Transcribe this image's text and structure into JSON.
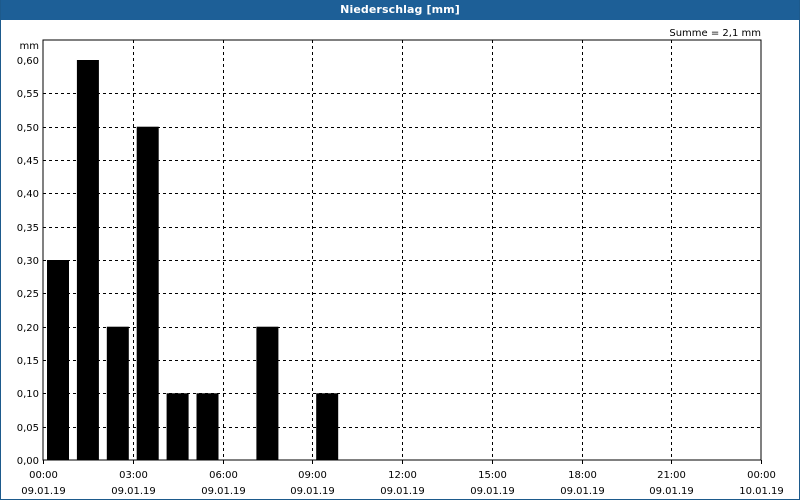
{
  "window": {
    "title": "Niederschlag [mm]"
  },
  "chart_data": {
    "type": "bar",
    "title": "Niederschlag [mm]",
    "unit_label": "mm",
    "annotation": "Summe = 2,1 mm",
    "ylim": [
      0,
      0.6
    ],
    "y_ticks": [
      "0,00",
      "0,05",
      "0,10",
      "0,15",
      "0,20",
      "0,25",
      "0,30",
      "0,35",
      "0,40",
      "0,45",
      "0,50",
      "0,55",
      "0,60"
    ],
    "x_ticks": [
      {
        "time": "00:00",
        "date": "09.01.19"
      },
      {
        "time": "03:00",
        "date": "09.01.19"
      },
      {
        "time": "06:00",
        "date": "09.01.19"
      },
      {
        "time": "09:00",
        "date": "09.01.19"
      },
      {
        "time": "12:00",
        "date": "09.01.19"
      },
      {
        "time": "15:00",
        "date": "09.01.19"
      },
      {
        "time": "18:00",
        "date": "09.01.19"
      },
      {
        "time": "21:00",
        "date": "09.01.19"
      },
      {
        "time": "00:00",
        "date": "10.01.19"
      }
    ],
    "categories": [
      "00:00",
      "01:00",
      "02:00",
      "03:00",
      "04:00",
      "05:00",
      "06:00",
      "07:00",
      "08:00",
      "09:00",
      "10:00",
      "11:00",
      "12:00",
      "13:00",
      "14:00",
      "15:00",
      "16:00",
      "17:00",
      "18:00",
      "19:00",
      "20:00",
      "21:00",
      "22:00",
      "23:00"
    ],
    "values": [
      0.3,
      0.6,
      0.2,
      0.5,
      0.1,
      0.1,
      0,
      0.2,
      0,
      0.1,
      0,
      0,
      0,
      0,
      0,
      0,
      0,
      0,
      0,
      0,
      0,
      0,
      0,
      0
    ],
    "grid": true,
    "colors": {
      "bars": "#000000",
      "titlebar": "#1d5f97",
      "grid": "#000000"
    }
  }
}
